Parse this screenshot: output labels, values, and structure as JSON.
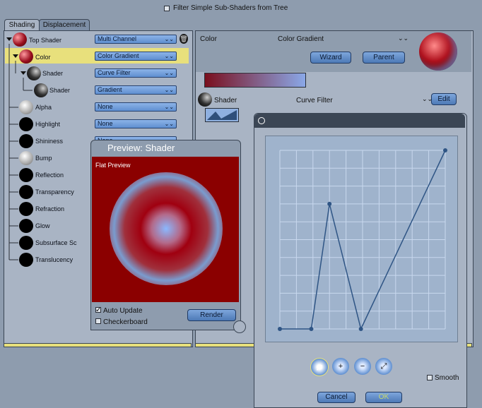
{
  "top_bar": {
    "filter_label": "Filter Simple Sub-Shaders from Tree",
    "filter_checked": false
  },
  "tabs": [
    {
      "label": "Shading"
    },
    {
      "label": "Displacement"
    }
  ],
  "tree": {
    "nodes": [
      {
        "label": "Top Shader",
        "value": "Multi Channel"
      },
      {
        "label": "Color",
        "value": "Color Gradient"
      },
      {
        "label": "Shader",
        "value": "Curve Filter"
      },
      {
        "label": "Shader",
        "value": "Gradient"
      },
      {
        "label": "Alpha",
        "value": "None"
      },
      {
        "label": "Highlight",
        "value": "None"
      },
      {
        "label": "Shininess",
        "value": "None"
      },
      {
        "label": "Bump"
      },
      {
        "label": "Reflection"
      },
      {
        "label": "Transparency"
      },
      {
        "label": "Refraction"
      },
      {
        "label": "Glow"
      },
      {
        "label": "Subsurface Sc"
      },
      {
        "label": "Translucency"
      }
    ]
  },
  "color_panel": {
    "label": "Color",
    "type": "Color Gradient",
    "wizard": "Wizard",
    "parent": "Parent",
    "gradient_start": "#7a0f1e",
    "gradient_end": "#8aa8e8"
  },
  "shader_row": {
    "label": "Shader",
    "type": "Curve Filter",
    "edit": "Edit"
  },
  "preview": {
    "title": "Preview: Shader",
    "mode": "Flat Preview",
    "auto_update": "Auto Update",
    "auto_update_checked": true,
    "checkerboard": "Checkerboard",
    "checkerboard_checked": false,
    "render": "Render"
  },
  "curve_editor": {
    "smooth_label": "Smooth",
    "smooth_checked": false,
    "cancel": "Cancel",
    "ok": "OK",
    "tools": [
      "select-arrow-icon",
      "add-point-icon",
      "delete-point-icon",
      "move-point-icon"
    ],
    "curve_points": [
      [
        0.0,
        0.0
      ],
      [
        0.19,
        0.0
      ],
      [
        0.3,
        0.7
      ],
      [
        0.49,
        0.0
      ],
      [
        1.0,
        1.0
      ]
    ]
  },
  "colors": {
    "accent": "#5f8fd0",
    "selected_row": "#e8e07c",
    "preview_bg": "#8b0000"
  }
}
